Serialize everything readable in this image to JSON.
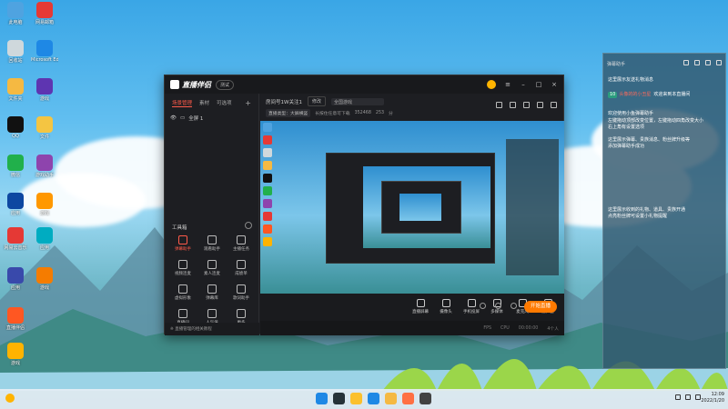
{
  "desktop": {
    "icons": [
      {
        "label": "此电脑",
        "color": "#4fa3e0"
      },
      {
        "label": "网易邮箱",
        "color": "#e53935"
      },
      {
        "label": "回收站",
        "color": "#cfd8dc"
      },
      {
        "label": "Microsoft Edge",
        "color": "#1e88e5"
      },
      {
        "label": "文件夹",
        "color": "#f5b942"
      },
      {
        "label": "游戏",
        "color": "#5e35b1"
      },
      {
        "label": "QQ",
        "color": "#111111"
      },
      {
        "label": "文件",
        "color": "#f4c542"
      },
      {
        "label": "微信",
        "color": "#21b04b"
      },
      {
        "label": "游戏助手",
        "color": "#8e44ad"
      },
      {
        "label": "应用",
        "color": "#0d47a1"
      },
      {
        "label": "游戏",
        "color": "#ff9800"
      },
      {
        "label": "网易云音乐",
        "color": "#e53935"
      },
      {
        "label": "应用",
        "color": "#00acc1"
      },
      {
        "label": "应用",
        "color": "#3949ab"
      },
      {
        "label": "游戏",
        "color": "#f57c00"
      },
      {
        "label": "直播伴侣",
        "color": "#ff5722"
      },
      {
        "label": "游戏",
        "color": "#ffb300"
      }
    ],
    "watermark": "创 四 二学"
  },
  "app": {
    "title": "直播伴侣",
    "version": "测试",
    "left_tabs": [
      "场景管理",
      "素材",
      "可选项"
    ],
    "scene": "全屏 1",
    "tools_title": "工具箱",
    "tools": [
      {
        "label": "弹幕助手",
        "active": true
      },
      {
        "label": "观看助手",
        "active": false
      },
      {
        "label": "主播任务",
        "active": false
      },
      {
        "label": "视频连麦",
        "active": false
      },
      {
        "label": "素人连麦",
        "active": false
      },
      {
        "label": "成绩单",
        "active": false
      },
      {
        "label": "虚拟形象",
        "active": false
      },
      {
        "label": "弹幕库",
        "active": false
      },
      {
        "label": "歌词助手",
        "active": false
      },
      {
        "label": "直播间",
        "active": false
      },
      {
        "label": "人气值",
        "active": false
      },
      {
        "label": "更多",
        "active": false
      }
    ],
    "footer": "※ 直播管理的相关教程",
    "room_title": "房间号1W关注1",
    "room_btn": "修改",
    "room_input": "全国游戏",
    "room_chips": [
      "直播类型：大屏横竖",
      "长按住任意可下载",
      "352468",
      "253",
      "分"
    ],
    "controls": [
      "直播屏幕",
      "摄像头",
      "手机投屏",
      "多媒体",
      "麦克风",
      "扬声器"
    ],
    "start_btn": "开始直播",
    "status": [
      "FPS",
      "CPU",
      "00:00:00",
      "4个人"
    ]
  },
  "chat": {
    "header": "弹幕助手",
    "messages": [
      {
        "text": "这里展示友送礼物消息",
        "badge": "",
        "name": "",
        "body": ""
      },
      {
        "text": "",
        "badge": "10",
        "name": "头像的的小丑星",
        "body": "欢迎来到本直播间"
      },
      {
        "text": "欢迎使用小鱼弹幕助手",
        "badge": "",
        "name": "",
        "body": ""
      },
      {
        "text": "左键拖动顶部改变位置，左键拖动四角改变大小",
        "badge": "",
        "name": "",
        "body": ""
      },
      {
        "text": "右上角有设置选项",
        "badge": "",
        "name": "",
        "body": ""
      },
      {
        "text": "这里展示弹幕、贵族消息、粉丝牌升级等",
        "badge": "",
        "name": "",
        "body": ""
      },
      {
        "text": "添加弹幕助手成功",
        "badge": "",
        "name": "",
        "body": ""
      },
      {
        "text": "这里展示收到的礼物、道具、贵族开通",
        "badge": "",
        "name": "",
        "body": ""
      },
      {
        "text": "点亮粉丝牌可设置小礼物提醒",
        "badge": "",
        "name": "",
        "body": ""
      }
    ]
  },
  "taskbar": {
    "time": "12:09",
    "date": "2022/1/20",
    "apps": [
      {
        "name": "start",
        "color": "#1e88e5"
      },
      {
        "name": "search",
        "color": "#263238"
      },
      {
        "name": "chrome",
        "color": "#fbc02d"
      },
      {
        "name": "edge",
        "color": "#1e88e5"
      },
      {
        "name": "folder",
        "color": "#f5b942"
      },
      {
        "name": "game",
        "color": "#ff7043"
      },
      {
        "name": "app",
        "color": "#424242"
      }
    ]
  }
}
